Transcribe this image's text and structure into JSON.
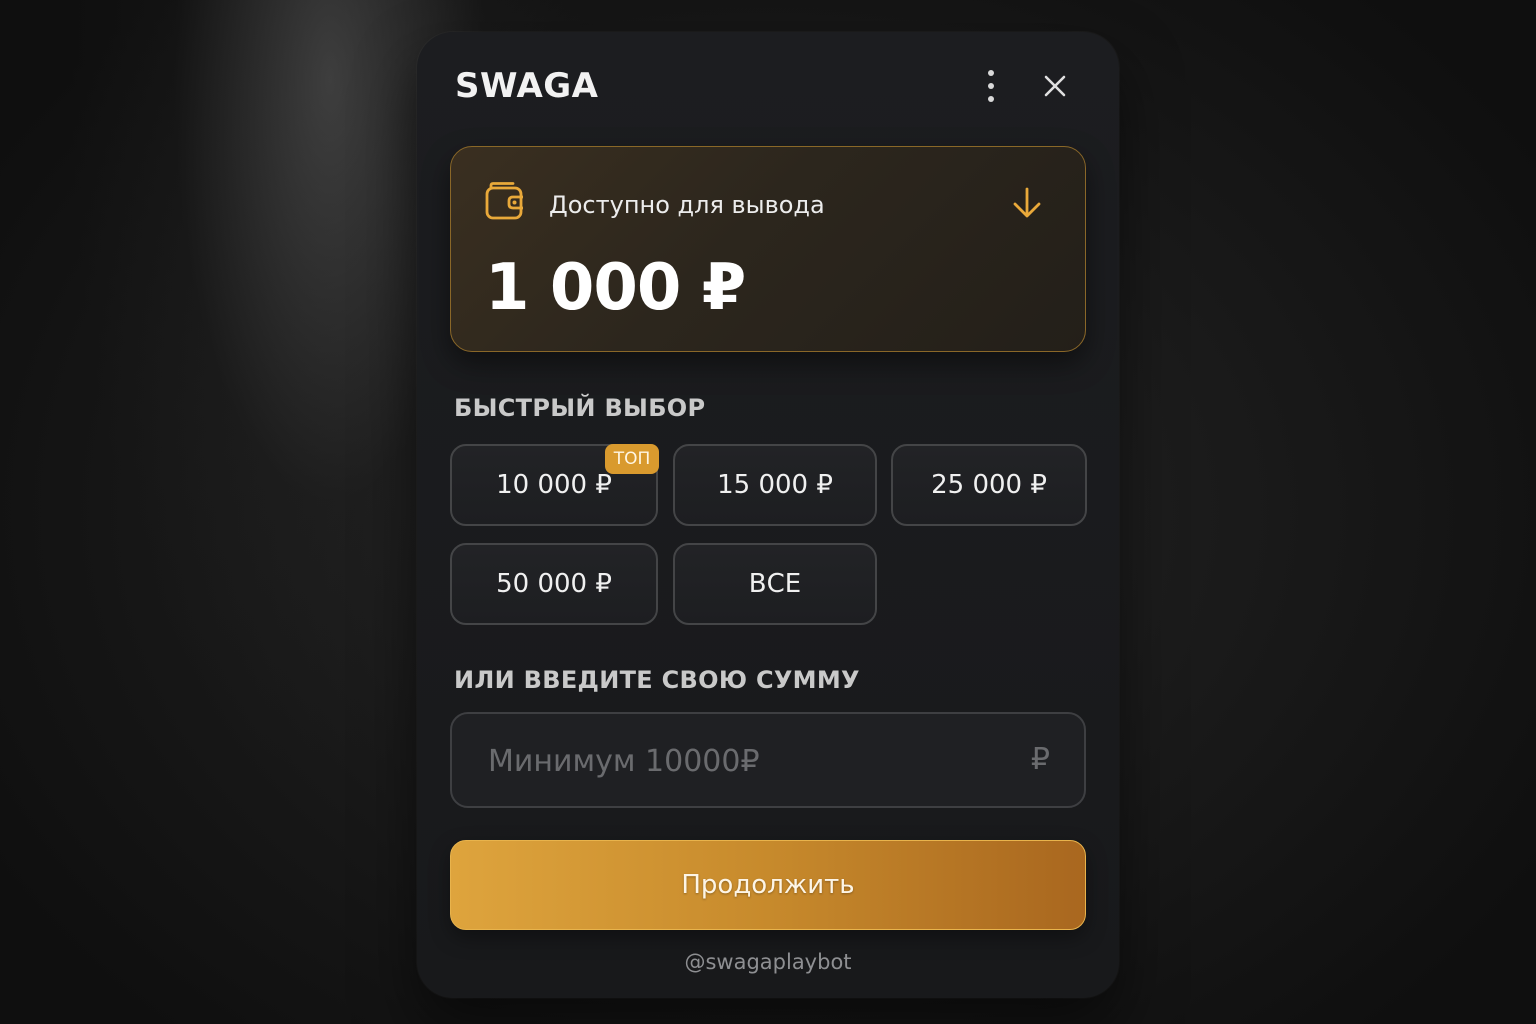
{
  "header": {
    "title": "SWAGA",
    "menu_icon": "more-vertical-icon",
    "close_icon": "close-icon"
  },
  "balance": {
    "label": "Доступно для вывода",
    "amount": "1 000 ₽",
    "wallet_icon": "wallet-icon",
    "action_icon": "arrow-down-icon",
    "accent_color": "#e9a93a"
  },
  "quick_select": {
    "label": "БЫСТРЫЙ ВЫБОР",
    "options": [
      {
        "label": "10 000 ₽",
        "badge": "ТОП"
      },
      {
        "label": "15 000 ₽"
      },
      {
        "label": "25 000 ₽"
      },
      {
        "label": "50 000 ₽"
      },
      {
        "label": "ВСЕ"
      }
    ]
  },
  "custom_amount": {
    "label": "ИЛИ ВВЕДИТЕ СВОЮ СУММУ",
    "value": "",
    "placeholder": "Минимум 10000₽",
    "currency": "₽"
  },
  "continue_button": {
    "label": "Продолжить",
    "color": "#d99a2e"
  },
  "footer": {
    "handle": "@swagaplaybot"
  }
}
